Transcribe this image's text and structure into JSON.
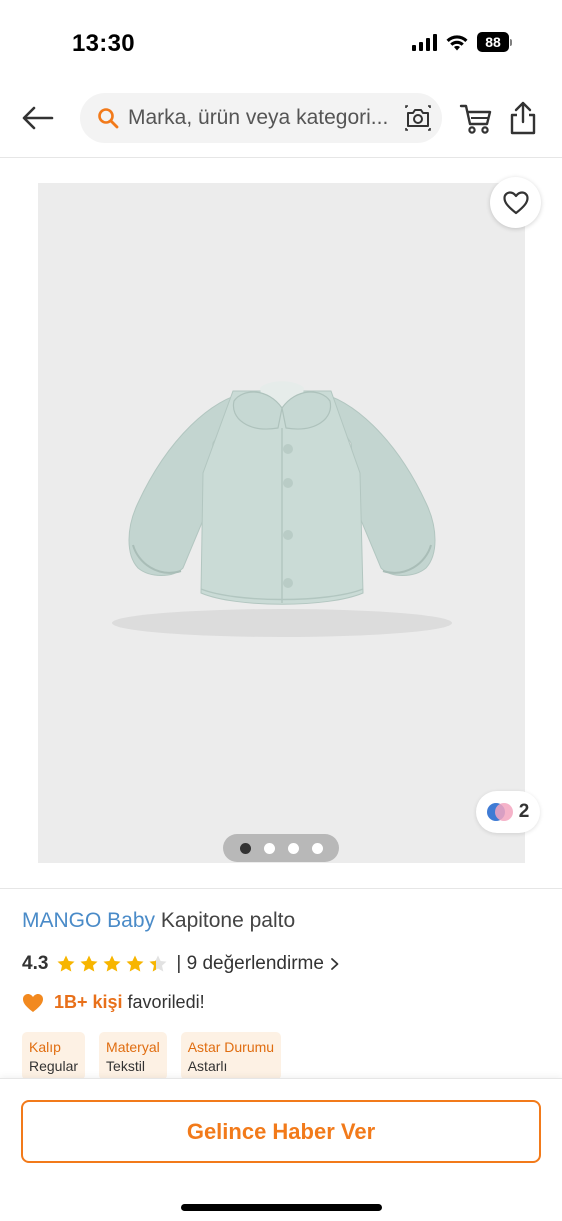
{
  "status_bar": {
    "time": "13:30",
    "battery": "88"
  },
  "header": {
    "back_icon": "arrow-left-icon",
    "search_placeholder": "Marka, ürün veya kategori...",
    "search_icon": "search-icon",
    "camera_icon": "camera-icon",
    "cart_icon": "cart-icon",
    "share_icon": "share-icon"
  },
  "gallery": {
    "favorite_icon": "heart-outline-icon",
    "color_variant_count": "2",
    "page_count": 4,
    "active_page": 1
  },
  "product": {
    "brand": "MANGO Baby",
    "name": "Kapitone palto",
    "rating": "4.3",
    "rating_value": 4.3,
    "review_text": "| 9 değerlendirme",
    "favorites_highlight": "1B+ kişi",
    "favorites_text": "favoriledi!"
  },
  "attributes": [
    {
      "label": "Kalıp",
      "value": "Regular"
    },
    {
      "label": "Materyal",
      "value": "Tekstil"
    },
    {
      "label": "Astar Durumu",
      "value": "Astarlı"
    }
  ],
  "cta": {
    "label": "Gelince Haber Ver"
  },
  "colors": {
    "accent": "#f27a1a",
    "brand_link": "#4a8bc8",
    "star": "#f7b500",
    "image_bg": "#ececec",
    "garment": "#c5d6d1"
  }
}
